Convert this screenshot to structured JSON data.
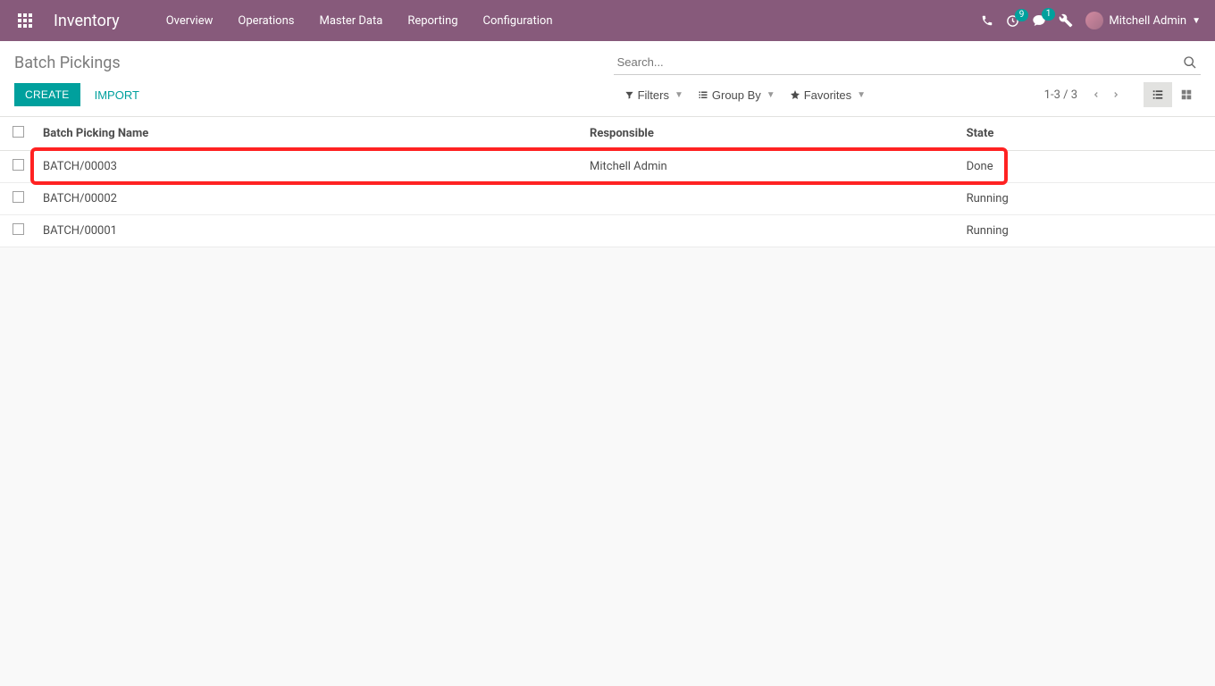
{
  "navbar": {
    "brand": "Inventory",
    "menu": [
      "Overview",
      "Operations",
      "Master Data",
      "Reporting",
      "Configuration"
    ],
    "notif_badge": "9",
    "msg_badge": "1",
    "user_name": "Mitchell Admin"
  },
  "cp": {
    "breadcrumb": "Batch Pickings",
    "search_placeholder": "Search...",
    "create_label": "CREATE",
    "import_label": "IMPORT",
    "filters_label": "Filters",
    "groupby_label": "Group By",
    "favorites_label": "Favorites",
    "pager": "1-3 / 3"
  },
  "table": {
    "headers": {
      "name": "Batch Picking Name",
      "responsible": "Responsible",
      "state": "State"
    },
    "rows": [
      {
        "name": "BATCH/00003",
        "responsible": "Mitchell Admin",
        "state": "Done",
        "highlight": true
      },
      {
        "name": "BATCH/00002",
        "responsible": "",
        "state": "Running",
        "highlight": false
      },
      {
        "name": "BATCH/00001",
        "responsible": "",
        "state": "Running",
        "highlight": false
      }
    ]
  }
}
